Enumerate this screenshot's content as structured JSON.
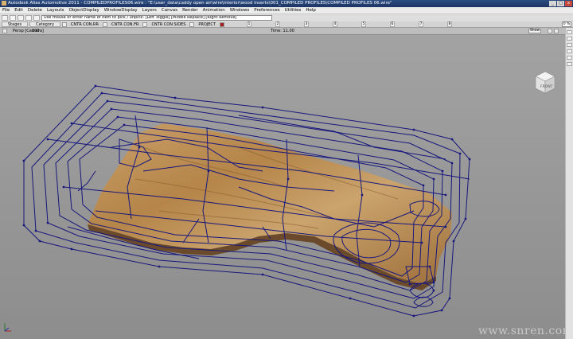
{
  "window": {
    "title": "Autodesk Alias Automotive 2011 - COMPILEDPROFILES06.wire : \"E:\\user_data\\caddy open air\\wire\\interior\\wood inserts\\001_COMPILED PROFILES\\COMPILED PROFILES 06.wire\"",
    "controls": [
      "_",
      "□",
      "x"
    ]
  },
  "menubar": {
    "items": [
      "File",
      "Edit",
      "Delete",
      "Layouts",
      "ObjectDisplay",
      "WindowDisplay",
      "Layers",
      "Canvas",
      "Render",
      "Animation",
      "Windows",
      "Preferences",
      "Utilities",
      "Help"
    ]
  },
  "toolbar": {
    "prompt_text": "Use mouse or enter name of item to pick / unpick: [Left Toggle] [Middle Replace] [Right Remove]"
  },
  "shelf": {
    "tabs": [
      "Stages",
      "Category"
    ],
    "items": [
      "CNTR CON.RR",
      "CNTR CON.FR",
      "CNTR CON SIDES",
      "PROJECT"
    ],
    "divisions": [
      "1",
      "2",
      "3",
      "4",
      "5",
      "6",
      "7",
      "8"
    ],
    "percent": "0 %"
  },
  "viewport": {
    "camera_label": "Persp [Camera]",
    "fov_label": "100",
    "time_label": "Time: 11.00",
    "show_button": "Show",
    "viewcube_label": "FRONT"
  },
  "watermark": "www.snren.com",
  "colors": {
    "curve": "#16167a",
    "wood": "#b8894f",
    "viewport_bg": "#999999",
    "title_bar": "#1f3a6c"
  }
}
